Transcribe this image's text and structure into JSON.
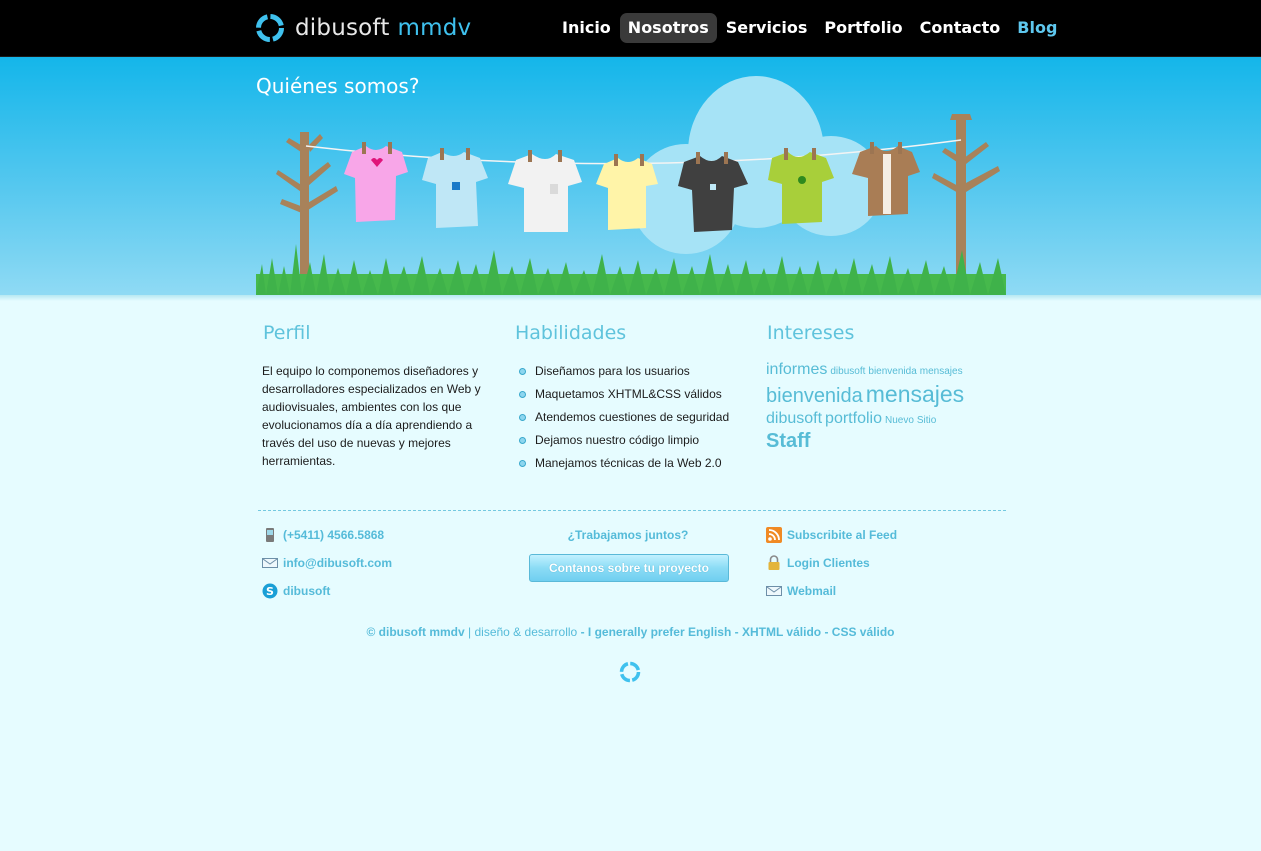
{
  "brand": {
    "name": "dibusoft",
    "suffix": "mmdv"
  },
  "nav": [
    {
      "label": "Inicio"
    },
    {
      "label": "Nosotros",
      "active": true
    },
    {
      "label": "Servicios"
    },
    {
      "label": "Portfolio"
    },
    {
      "label": "Contacto"
    },
    {
      "label": "Blog"
    }
  ],
  "hero": {
    "title": "Quiénes somos?"
  },
  "perfil": {
    "title": "Perfil",
    "text": "El equipo lo componemos diseñadores y desarrolladores especializados en Web y audiovisuales, ambientes con los que evolucionamos día a día aprendiendo a través del uso de nuevas y mejores herramientas."
  },
  "habilidades": {
    "title": "Habilidades",
    "items": [
      "Diseñamos para los usuarios",
      "Maquetamos XHTML&CSS válidos",
      "Atendemos cuestiones de seguridad",
      "Dejamos nuestro código limpio",
      "Manejamos técnicas de la Web 2.0"
    ]
  },
  "intereses": {
    "title": "Intereses",
    "tags": [
      "informes",
      "dibusoft",
      "bienvenida",
      "mensajes",
      "bienvenida",
      "mensajes",
      "dibusoft",
      "portfolio",
      "Nuevo",
      "Sitio",
      "Staff"
    ]
  },
  "contact": {
    "phone": "(+5411) 4566.5868",
    "email": "info@dibusoft.com",
    "skype": "dibusoft"
  },
  "cta": {
    "question": "¿Trabajamos juntos?",
    "button": "Contanos sobre tu proyecto"
  },
  "links": {
    "feed": "Subscribite al Feed",
    "login": "Login Clientes",
    "webmail": "Webmail"
  },
  "footer": {
    "copyright": "© dibusoft mmdv",
    "tagline": "| diseño & desarrollo",
    "sep1": "-",
    "english": "I generally prefer English",
    "sep2": "-",
    "xhtml": "XHTML válido",
    "sep3": "-",
    "css": "CSS válido"
  },
  "colors": {
    "accent": "#3fc1ee",
    "link": "#55bbd9",
    "sky": "#14b6ea",
    "background": "#e6fcff"
  }
}
